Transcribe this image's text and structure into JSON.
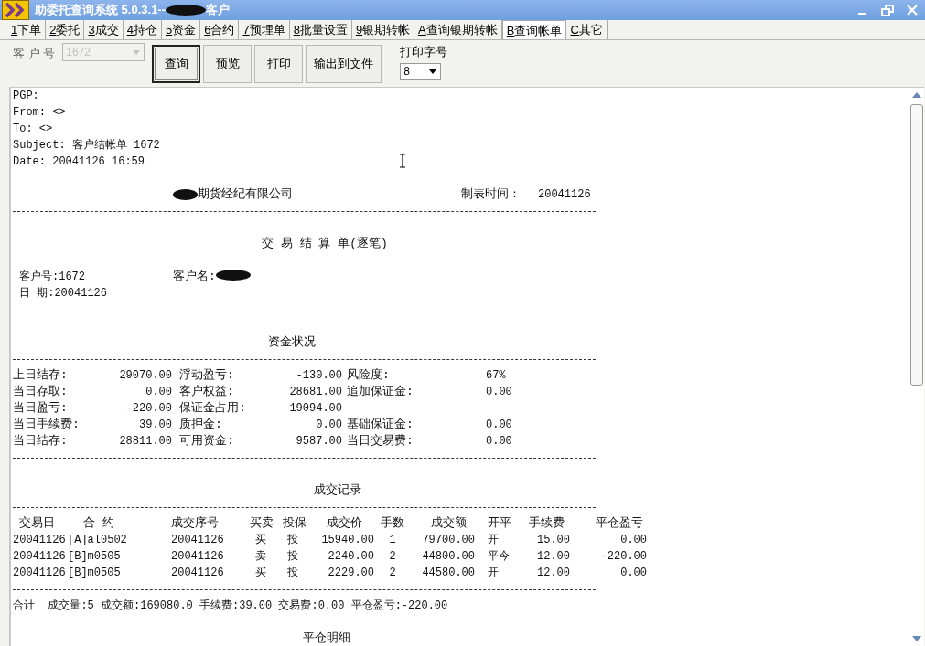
{
  "window": {
    "title": "助委托查询系统 5.0.3.1--",
    "title_suffix": "客户"
  },
  "tabs": [
    {
      "key": "1",
      "label": "下单",
      "selected": false
    },
    {
      "key": "2",
      "label": "委托",
      "selected": false
    },
    {
      "key": "3",
      "label": "成交",
      "selected": false
    },
    {
      "key": "4",
      "label": "持仓",
      "selected": false
    },
    {
      "key": "5",
      "label": "资金",
      "selected": false
    },
    {
      "key": "6",
      "label": "合约",
      "selected": false
    },
    {
      "key": "7",
      "label": "预埋单",
      "selected": false
    },
    {
      "key": "8",
      "label": "批量设置",
      "selected": false
    },
    {
      "key": "9",
      "label": "银期转帐",
      "selected": false
    },
    {
      "key": "A",
      "label": "查询银期转帐",
      "selected": false
    },
    {
      "key": "B",
      "label": "查询帐单",
      "selected": true
    },
    {
      "key": "C",
      "label": "其它",
      "selected": false
    }
  ],
  "toolbar": {
    "customer_label": "客 户 号",
    "customer_field": {
      "value": "1672",
      "disabled": true
    },
    "buttons": [
      {
        "label": "查询",
        "focused": true
      },
      {
        "label": "预览",
        "focused": false
      },
      {
        "label": "打印",
        "focused": false
      },
      {
        "label": "输出到文件",
        "focused": false
      }
    ],
    "font_size_label": "打印字号",
    "font_size": {
      "value": "8"
    }
  },
  "report": {
    "header_lines": [
      "PGP:",
      "From: <>",
      "To: <>",
      "Subject: 客户结帐单 1672",
      "Date: 20041126 16:59"
    ],
    "company": "期货经纪有限公司",
    "made_time_label": "制表时间：",
    "made_time": "20041126",
    "title": "交 易 结 算 单(逐笔)",
    "customer_no": "客户号:1672",
    "customer_name_label": "客户名:",
    "date": "日 期:20041126",
    "funds": {
      "title": "资金状况",
      "rows": [
        [
          {
            "label": "上日结存:",
            "value": "29070.00"
          },
          {
            "label": "浮动盈亏:",
            "value": "-130.00"
          },
          {
            "label": "风险度:",
            "value": "67%"
          }
        ],
        [
          {
            "label": "当日存取:",
            "value": "0.00"
          },
          {
            "label": "客户权益:",
            "value": "28681.00"
          },
          {
            "label": "追加保证金:",
            "value": "0.00"
          }
        ],
        [
          {
            "label": "当日盈亏:",
            "value": "-220.00"
          },
          {
            "label": "保证金占用:",
            "value": "19094.00"
          }
        ],
        [
          {
            "label": "当日手续费:",
            "value": "39.00"
          },
          {
            "label": "质押金:",
            "value": "0.00"
          },
          {
            "label": "基础保证金:",
            "value": "0.00"
          }
        ],
        [
          {
            "label": "当日结存:",
            "value": "28811.00"
          },
          {
            "label": "可用资金:",
            "value": "9587.00"
          },
          {
            "label": "当日交易费:",
            "value": "0.00"
          }
        ]
      ]
    },
    "trades": {
      "title": "成交记录",
      "columns": [
        "交易日",
        "合 约",
        "成交序号",
        "买卖",
        "投保",
        "成交价",
        "手数",
        "成交额",
        "开平",
        "手续费",
        "平仓盈亏"
      ],
      "rows": [
        [
          "20041126",
          "[A]al0502",
          "20041126",
          "买",
          "投",
          "15940.00",
          "1",
          "79700.00",
          "开",
          "15.00",
          "0.00"
        ],
        [
          "20041126",
          "[B]m0505",
          "20041126",
          "卖",
          "投",
          "2240.00",
          "2",
          "44800.00",
          "平今",
          "12.00",
          "-220.00"
        ],
        [
          "20041126",
          "[B]m0505",
          "20041126",
          "买",
          "投",
          "2229.00",
          "2",
          "44580.00",
          "开",
          "12.00",
          "0.00"
        ]
      ]
    },
    "total": "合计  成交量:5 成交额:169080.0 手续费:39.00 交易费:0.00 平仓盈亏:-220.00",
    "next_section": "平仓明细"
  }
}
